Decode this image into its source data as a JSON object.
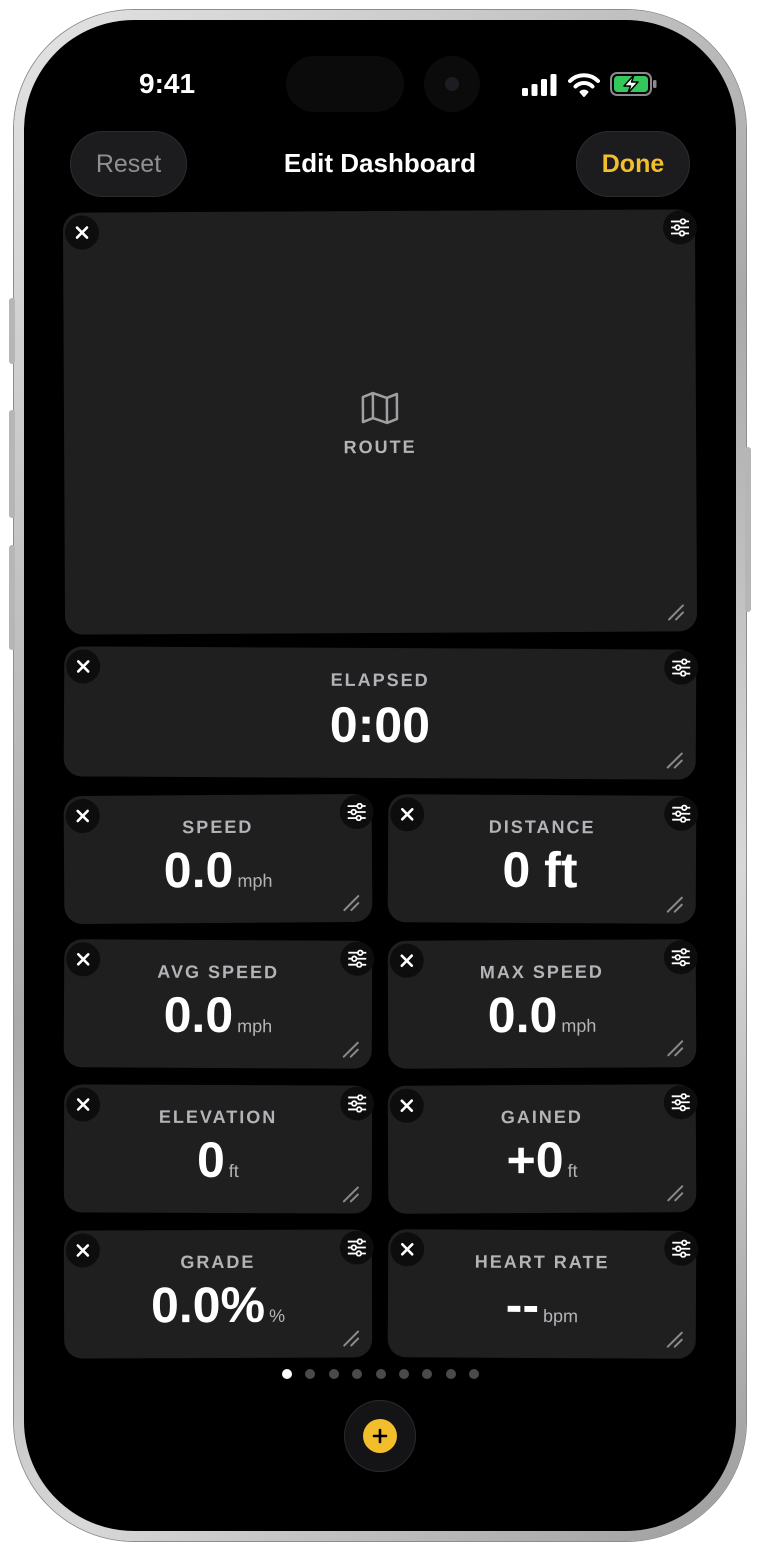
{
  "status_bar": {
    "time": "9:41"
  },
  "header": {
    "reset_label": "Reset",
    "title": "Edit Dashboard",
    "done_label": "Done"
  },
  "route_card": {
    "label": "ROUTE",
    "icon": "map-icon"
  },
  "elapsed_card": {
    "label": "ELAPSED",
    "value": "0:00"
  },
  "tiles": [
    {
      "label": "SPEED",
      "value": "0.0",
      "unit": "mph"
    },
    {
      "label": "DISTANCE",
      "value": "0 ft",
      "unit": ""
    },
    {
      "label": "AVG SPEED",
      "value": "0.0",
      "unit": "mph"
    },
    {
      "label": "MAX SPEED",
      "value": "0.0",
      "unit": "mph"
    },
    {
      "label": "ELEVATION",
      "value": "0",
      "unit": "ft"
    },
    {
      "label": "GAINED",
      "value": "+0",
      "unit": "ft"
    },
    {
      "label": "GRADE",
      "value": "0.0%",
      "unit": "%"
    },
    {
      "label": "HEART RATE",
      "value": "--",
      "unit": "bpm"
    }
  ],
  "pager": {
    "pages": 9,
    "current": 1
  },
  "colors": {
    "accent": "#f2be2c",
    "card": "#1f1f20",
    "background": "#000000",
    "battery": "#34c759"
  },
  "icons": {
    "remove": "close-icon",
    "settings": "sliders-icon",
    "resize": "resize-handle-icon",
    "add": "plus-icon"
  }
}
